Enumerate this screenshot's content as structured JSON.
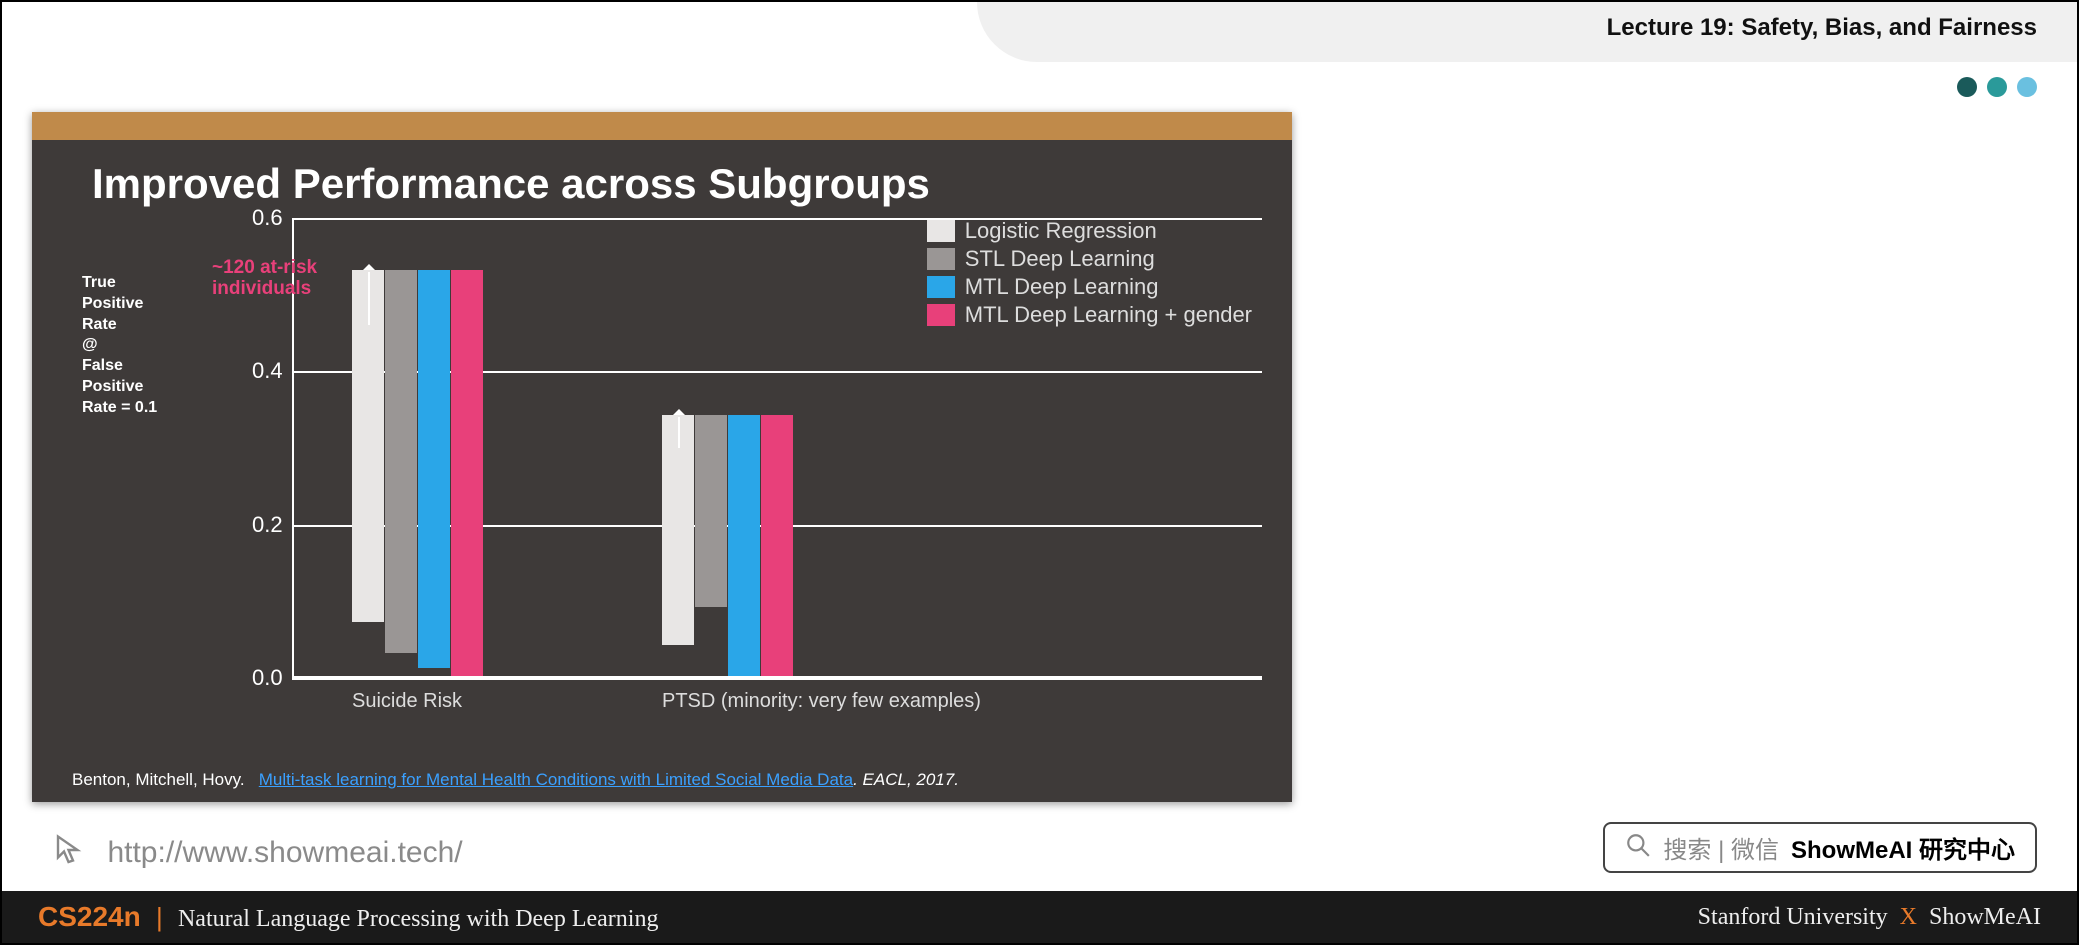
{
  "header": {
    "lecture_title": "Lecture 19: Safety, Bias, and Fairness"
  },
  "slide": {
    "title": "Improved Performance across Subgroups",
    "ylabel_lines": "True\nPositive\nRate\n@\nFalse\nPositive\nRate = 0.1",
    "annotation": "~120 at-risk\nindividuals",
    "citation_authors": "Benton, Mitchell, Hovy.",
    "citation_link": "Multi-task learning for Mental Health Conditions with Limited Social Media Data",
    "citation_venue": ". EACL, 2017."
  },
  "chart_data": {
    "type": "bar",
    "ylabel": "True Positive Rate @ False Positive Rate = 0.1",
    "ylim": [
      0.0,
      0.6
    ],
    "ticks": [
      "0.0",
      "0.2",
      "0.4",
      "0.6"
    ],
    "categories": [
      "Suicide Risk",
      "PTSD  (minority: very few examples)"
    ],
    "series": [
      {
        "name": "Logistic Regression",
        "color": "#e8e6e5",
        "values": [
          0.46,
          0.3
        ]
      },
      {
        "name": "STL Deep Learning",
        "color": "#9a9695",
        "values": [
          0.5,
          0.25
        ]
      },
      {
        "name": "MTL Deep Learning",
        "color": "#2aa6e8",
        "values": [
          0.52,
          0.34
        ]
      },
      {
        "name": "MTL Deep Learning + gender",
        "color": "#e8407a",
        "values": [
          0.53,
          0.34
        ]
      }
    ]
  },
  "url_row": {
    "url": "http://www.showmeai.tech/",
    "search_hint": "搜索 | 微信",
    "search_brand": "ShowMeAI 研究中心"
  },
  "footer": {
    "course": "CS224n",
    "subtitle": "Natural Language Processing with Deep Learning",
    "right_a": "Stanford University",
    "right_x": "X",
    "right_b": "ShowMeAI"
  }
}
